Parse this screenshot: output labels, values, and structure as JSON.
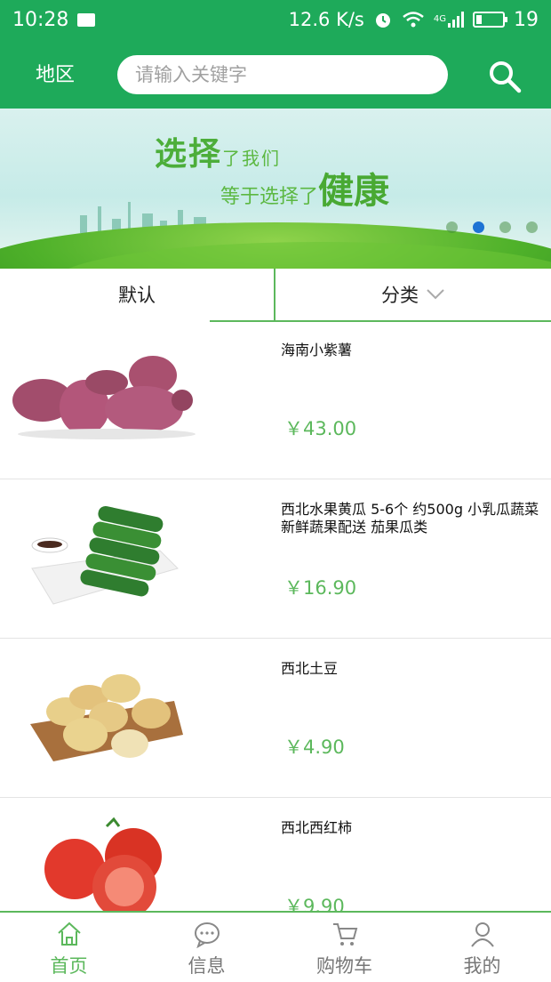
{
  "status_bar": {
    "time": "10:28",
    "speed": "12.6 K/s",
    "network": "4G",
    "battery": "19"
  },
  "header": {
    "region_label": "地区",
    "search_placeholder": "请输入关键字"
  },
  "banner": {
    "slogan_big1": "选择",
    "slogan_small1": "了我们",
    "slogan_small2": "等于选择了",
    "slogan_big2": "健康",
    "slide_count": 4,
    "active_slide": 2
  },
  "sort_bar": {
    "default_label": "默认",
    "category_label": "分类"
  },
  "products": [
    {
      "name": "海南小紫薯",
      "price": "￥43.00",
      "image": "purple-sweet-potato-image"
    },
    {
      "name": "西北水果黄瓜 5-6个 约500g 小乳瓜蔬菜新鲜蔬果配送 茄果瓜类",
      "price": "￥16.90",
      "image": "cucumber-image"
    },
    {
      "name": "西北土豆",
      "price": "￥4.90",
      "image": "potato-image"
    },
    {
      "name": "西北西红柿",
      "price": "￥9.90",
      "image": "tomato-image"
    }
  ],
  "tabbar": {
    "tabs": [
      {
        "label": "首页",
        "icon": "home-icon"
      },
      {
        "label": "信息",
        "icon": "message-icon"
      },
      {
        "label": "购物车",
        "icon": "cart-icon"
      },
      {
        "label": "我的",
        "icon": "user-icon"
      }
    ]
  },
  "colors": {
    "brand": "#1eaa5a",
    "accent_green": "#5cb85c",
    "dot_active": "#1e73d4"
  }
}
